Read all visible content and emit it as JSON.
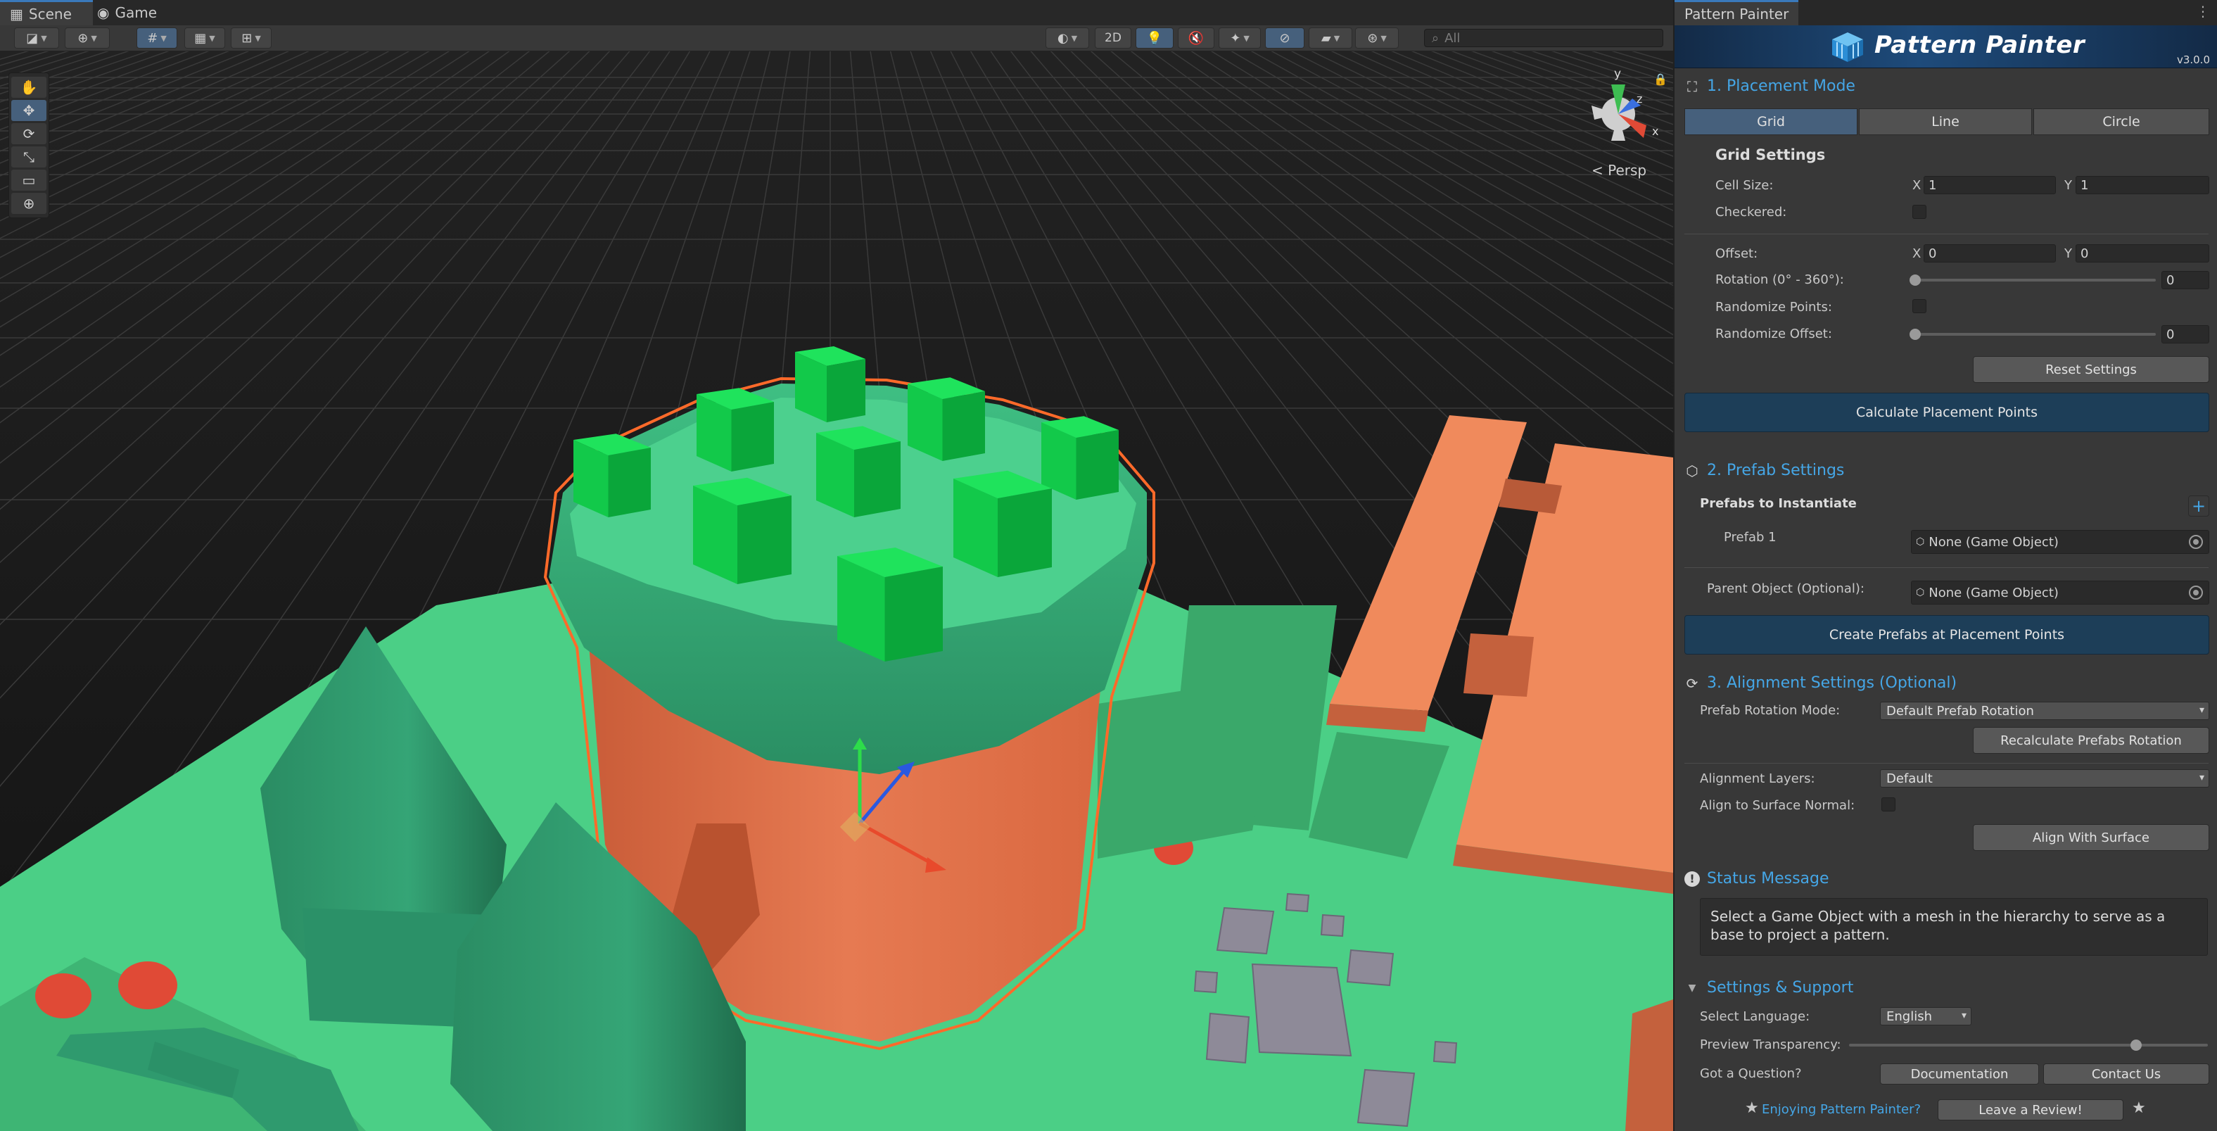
{
  "scene": {
    "tabs": [
      {
        "label": "Scene",
        "icon": "scene-grid-icon"
      },
      {
        "label": "Game",
        "icon": "gamepad-icon"
      }
    ],
    "toolbar": {
      "mode_2d": "2D",
      "search_placeholder": "All"
    },
    "view_label": "< Persp",
    "gizmo_axes": {
      "x": "x",
      "y": "y",
      "z": "z"
    }
  },
  "panel": {
    "tab_title": "Pattern Painter",
    "banner_title": "Pattern Painter",
    "version": "v3.0.0",
    "placement": {
      "heading": "1. Placement Mode",
      "modes": [
        "Grid",
        "Line",
        "Circle"
      ],
      "active_mode": "Grid",
      "grid_settings_title": "Grid Settings",
      "cell_size_label": "Cell Size:",
      "cell_size": {
        "x": "1",
        "y": "1"
      },
      "checkered_label": "Checkered:",
      "offset_label": "Offset:",
      "offset": {
        "x": "0",
        "y": "0"
      },
      "rotation_label": "Rotation (0° - 360°):",
      "rotation_value": "0",
      "randomize_points_label": "Randomize Points:",
      "randomize_offset_label": "Randomize Offset:",
      "randomize_offset_value": "0",
      "axis_x": "X",
      "axis_y": "Y",
      "reset_button": "Reset Settings",
      "calculate_button": "Calculate Placement Points"
    },
    "prefab": {
      "heading": "2. Prefab Settings",
      "prefabs_title": "Prefabs to Instantiate",
      "add_button": "+",
      "prefab1_label": "Prefab 1",
      "prefab1_value": "None (Game Object)",
      "parent_label": "Parent Object (Optional):",
      "parent_value": "None (Game Object)",
      "create_button": "Create Prefabs at Placement Points"
    },
    "alignment": {
      "heading": "3. Alignment Settings (Optional)",
      "rotation_mode_label": "Prefab Rotation Mode:",
      "rotation_mode_value": "Default Prefab Rotation",
      "recalculate_button": "Recalculate Prefabs Rotation",
      "layers_label": "Alignment Layers:",
      "layers_value": "Default",
      "surface_normal_label": "Align to Surface Normal:",
      "align_button": "Align With Surface"
    },
    "status": {
      "heading": "Status Message",
      "message": "Select a Game Object with a mesh in the hierarchy to serve as a base to project a pattern."
    },
    "support": {
      "heading": "Settings & Support",
      "language_label": "Select Language:",
      "language_value": "English",
      "transparency_label": "Preview Transparency:",
      "transparency_value": 0.8,
      "question_label": "Got a Question?",
      "documentation_button": "Documentation",
      "contact_button": "Contact Us"
    },
    "footer": {
      "enjoying_text": "Enjoying Pattern Painter?",
      "review_button": "Leave a Review!"
    }
  },
  "colors": {
    "accent_blue": "#45a6e6",
    "ground_green": "#4bcf86",
    "foliage_green": "#2f9a6e",
    "pot_orange": "#e1744d",
    "preview_cube": "#12c94a",
    "selection_outline": "#ff6a2a"
  }
}
